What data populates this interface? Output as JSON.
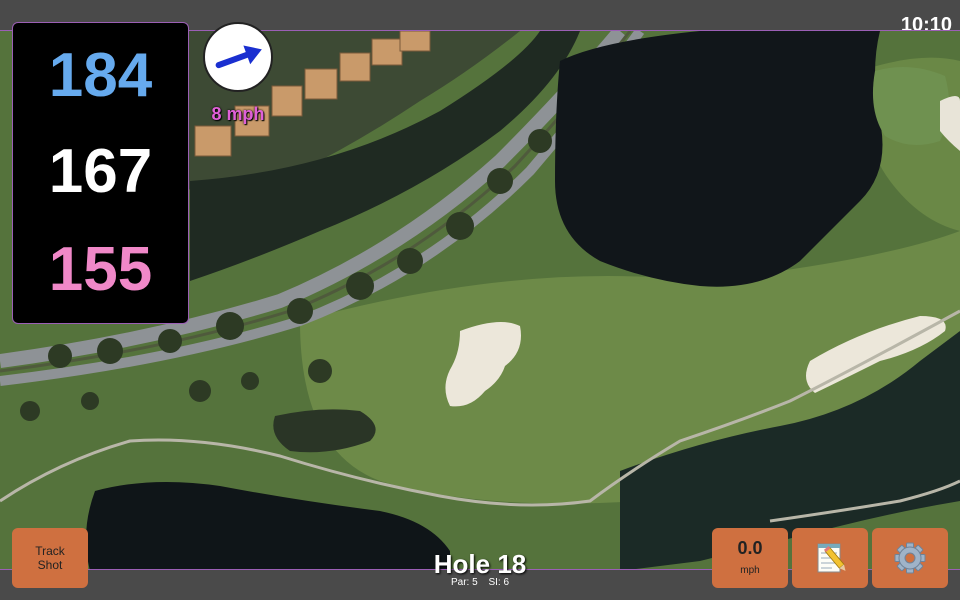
{
  "status": {
    "time": "10:10"
  },
  "distances": {
    "back": "184",
    "middle": "167",
    "front": "155",
    "back_color": "#66aaee",
    "middle_color": "#ffffff",
    "front_color": "#f088c8"
  },
  "wind": {
    "speed": "8 mph",
    "icon": "wind-arrow-icon"
  },
  "hole": {
    "title": "Hole 18",
    "par": "Par: 5",
    "si": "SI: 6"
  },
  "buttons": {
    "track_line1": "Track",
    "track_line2": "Shot",
    "speed_value": "0.0",
    "speed_unit": "mph",
    "notes_icon": "notepad-icon",
    "settings_icon": "gear-icon"
  },
  "colors": {
    "accent_border": "#9b5fb5",
    "button": "#cf7040"
  }
}
